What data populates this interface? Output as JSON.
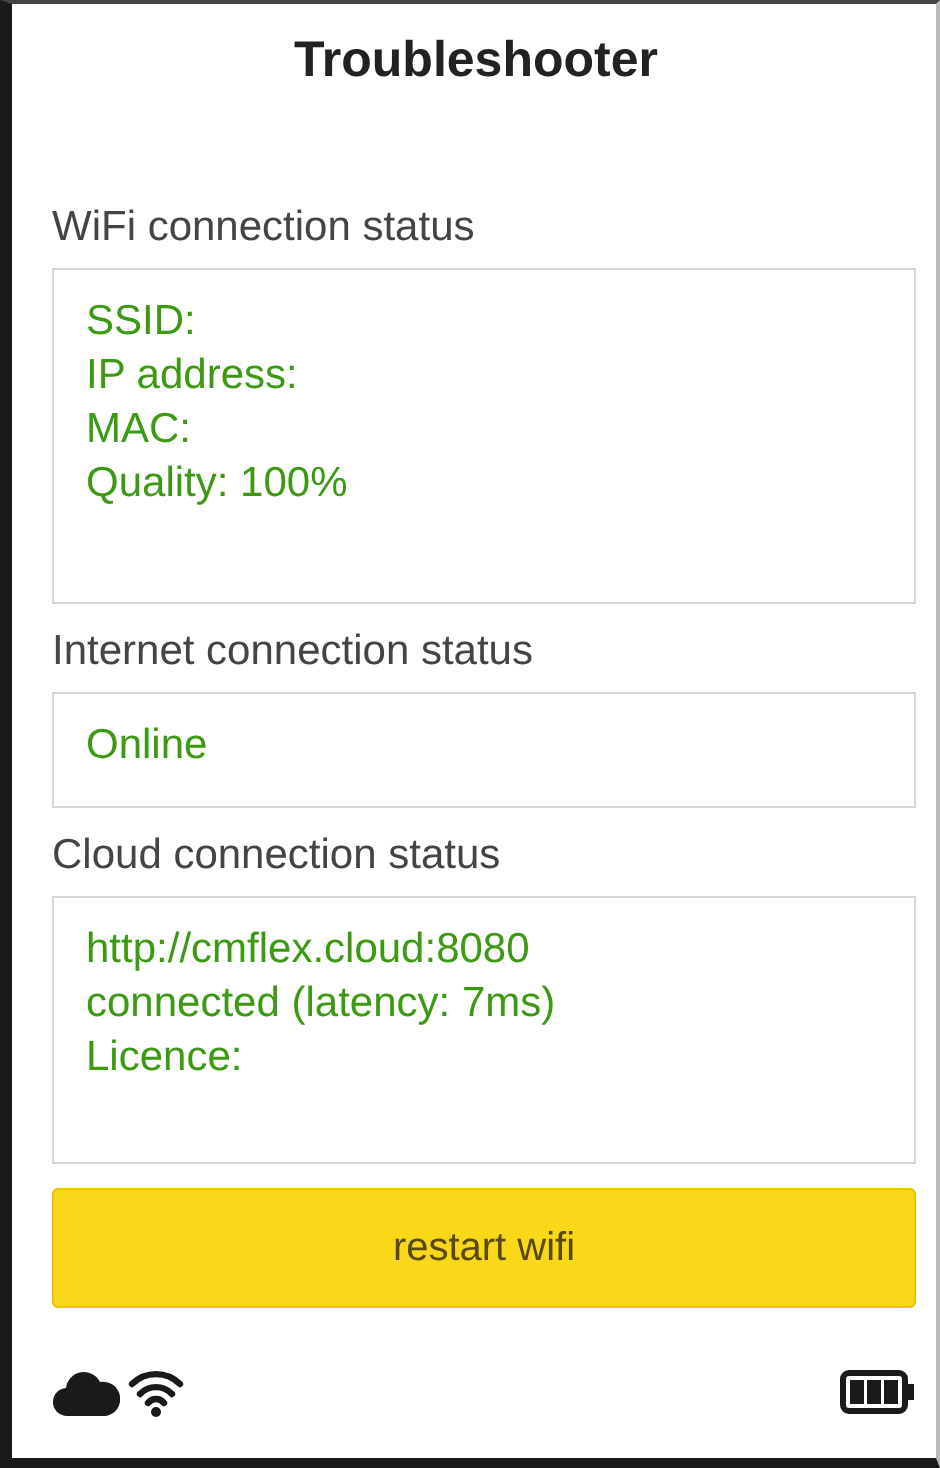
{
  "title": "Troubleshooter",
  "sections": [
    {
      "label": "WiFi connection status",
      "lines": [
        "SSID:",
        "IP address:",
        "MAC:",
        "Quality: 100%"
      ]
    },
    {
      "label": "Internet connection status",
      "lines": [
        "Online"
      ]
    },
    {
      "label": "Cloud connection status",
      "lines": [
        "http://cmflex.cloud:8080",
        "connected (latency: 7ms)",
        "Licence:"
      ]
    }
  ],
  "button": "restart wifi",
  "status_bar": {
    "cloud": true,
    "wifi": true
  }
}
